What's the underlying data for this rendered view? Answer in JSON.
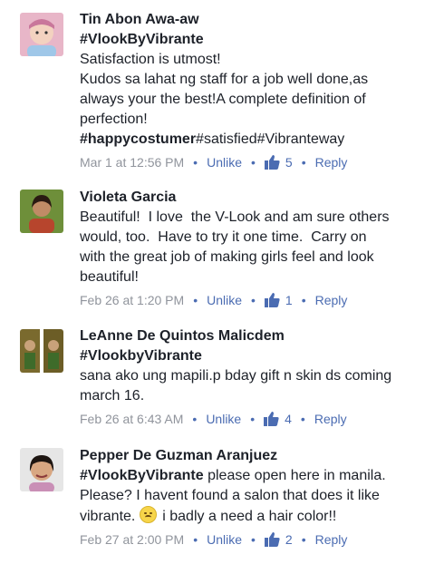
{
  "comments": [
    {
      "name": "Tin Abon Awa-aw",
      "lines": [
        [
          {
            "t": "#VlookByVibrante",
            "b": true
          }
        ],
        [
          {
            "t": "Satisfaction is utmost!"
          }
        ],
        [
          {
            "t": "Kudos sa lahat ng staff for a job well done,as"
          }
        ],
        [
          {
            "t": "always your the best!A complete definition of"
          }
        ],
        [
          {
            "t": "perfection!"
          }
        ],
        [
          {
            "t": "#happycostumer",
            "b": true
          },
          {
            "t": "#satisfied#Vibranteway"
          }
        ]
      ],
      "time": "Mar 1 at 12:56 PM",
      "unlike": "Unlike",
      "likes": "5",
      "reply": "Reply"
    },
    {
      "name": "Violeta Garcia",
      "lines": [
        [
          {
            "t": "Beautiful!  I love  the V-Look and am sure others"
          }
        ],
        [
          {
            "t": "would, too.  Have to try it one time.  Carry on"
          }
        ],
        [
          {
            "t": "with the great job of making girls feel and look"
          }
        ],
        [
          {
            "t": "beautiful!"
          }
        ]
      ],
      "time": "Feb 26 at 1:20 PM",
      "unlike": "Unlike",
      "likes": "1",
      "reply": "Reply"
    },
    {
      "name": "LeAnne De Quintos Malicdem",
      "lines": [
        [
          {
            "t": "#VlookbyVibrante",
            "b": true
          }
        ],
        [
          {
            "t": "sana ako ung mapili.p bday gift n skin ds coming"
          }
        ],
        [
          {
            "t": "march 16."
          }
        ]
      ],
      "time": "Feb 26 at 6:43 AM",
      "unlike": "Unlike",
      "likes": "4",
      "reply": "Reply"
    },
    {
      "name": "Pepper De Guzman Aranjuez",
      "lines": [
        [
          {
            "t": "#VlookByVibrante",
            "b": true
          },
          {
            "t": " please open here in manila."
          }
        ],
        [
          {
            "t": "Please? I havent found a salon that does it like"
          }
        ],
        [
          {
            "t": "vibrante. "
          },
          {
            "emoji": "disappointed-face"
          },
          {
            "t": " i badly a need a hair color!!"
          }
        ]
      ],
      "time": "Feb 27 at 2:00 PM",
      "unlike": "Unlike",
      "likes": "2",
      "reply": "Reply"
    }
  ],
  "colors": {
    "link": "#4b6cb2",
    "meta": "#90949c",
    "text": "#1d2129"
  }
}
